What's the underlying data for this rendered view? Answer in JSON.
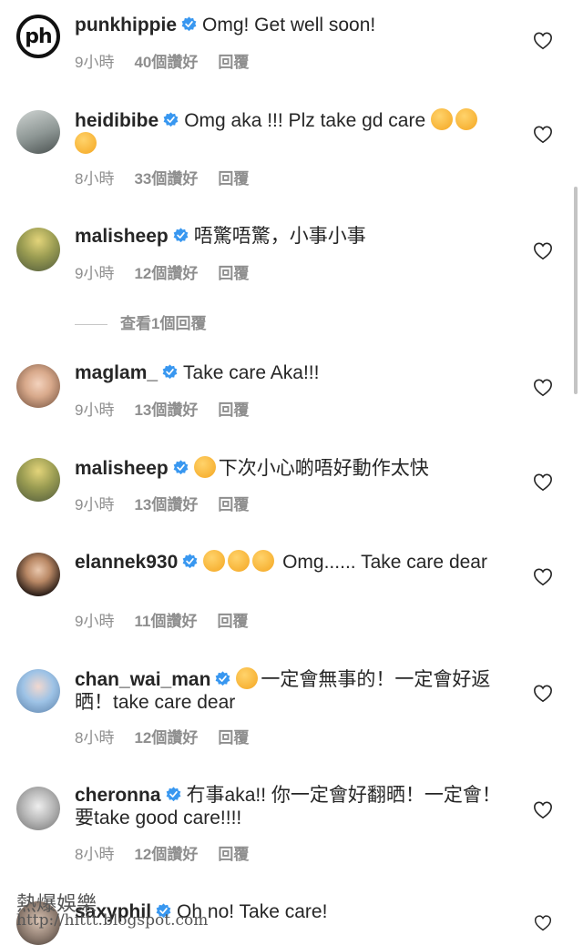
{
  "comments": [
    {
      "username": "punkhippie",
      "avatar_text": "ph",
      "text": "Omg! Get well soon!",
      "time": "9小時",
      "likes": "40個讚好",
      "reply": "回覆"
    },
    {
      "username": "heidibibe",
      "text": "Omg aka !!! Plz take gd care",
      "time": "8小時",
      "likes": "33個讚好",
      "reply": "回覆"
    },
    {
      "username": "malisheep",
      "text": "唔驚唔驚，小事小事",
      "time": "9小時",
      "likes": "12個讚好",
      "reply": "回覆",
      "view_replies": "查看1個回覆"
    },
    {
      "username": "maglam_",
      "text": "Take care Aka!!!",
      "time": "9小時",
      "likes": "13個讚好",
      "reply": "回覆"
    },
    {
      "username": "malisheep",
      "text": "下次小心啲唔好動作太快",
      "time": "9小時",
      "likes": "13個讚好",
      "reply": "回覆"
    },
    {
      "username": "elannek930",
      "text": "Omg...... Take care dear",
      "time": "9小時",
      "likes": "11個讚好",
      "reply": "回覆"
    },
    {
      "username": "chan_wai_man",
      "text": "一定會無事的！一定會好返晒！take care dear",
      "time": "8小時",
      "likes": "12個讚好",
      "reply": "回覆"
    },
    {
      "username": "cheronna",
      "text": "冇事aka!! 你一定會好翻晒！一定會！要take good care!!!!",
      "time": "8小時",
      "likes": "12個讚好",
      "reply": "回覆"
    },
    {
      "username": "saxyphil",
      "text": "Oh no! Take care!"
    }
  ],
  "watermark": {
    "line1": "熱爆娛樂",
    "line2": "http://hittt.blogspot.com"
  },
  "colors": {
    "text": "#262626",
    "meta": "#8e8e8e",
    "verified": "#3897f0",
    "background": "#ffffff"
  }
}
